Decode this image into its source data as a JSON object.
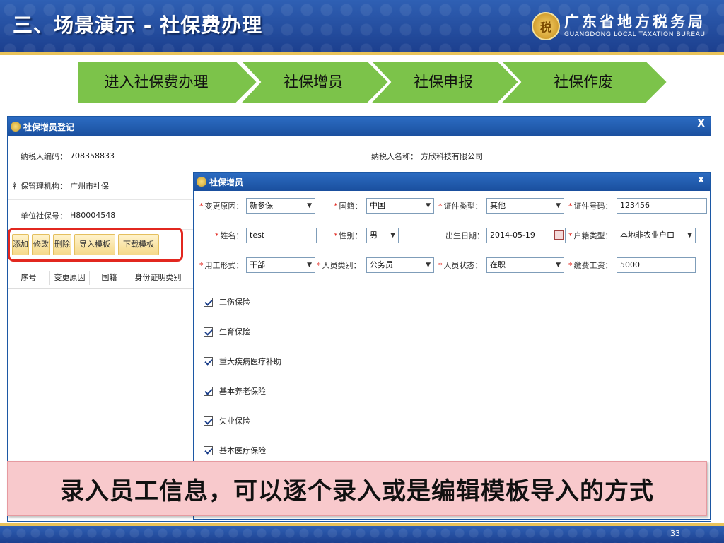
{
  "slide": {
    "title": "三、场景演示 - 社保费办理",
    "bureau_cn": "广东省地方税务局",
    "bureau_en": "GUANGDONG LOCAL TAXATION BUREAU",
    "page_number": "33"
  },
  "steps": [
    "进入社保费办理",
    "社保增员",
    "社保申报",
    "社保作废"
  ],
  "outer_dialog": {
    "title": "社保增员登记",
    "close": "X",
    "fields": {
      "taxpayer_id_label": "纳税人编码：",
      "taxpayer_id": "708358833",
      "taxpayer_name_label": "纳税人名称：",
      "taxpayer_name": "方欣科技有限公司",
      "agency_label": "社保管理机构：",
      "agency": "广州市社保",
      "unit_no_label": "单位社保号：",
      "unit_no": "H80004548"
    },
    "toolbar": [
      "添加",
      "修改",
      "删除",
      "导入模板",
      "下载模板"
    ],
    "grid_columns": [
      "序号",
      "变更原因",
      "国籍",
      "身份证明类别"
    ]
  },
  "inner_dialog": {
    "title": "社保增员",
    "close": "x",
    "required_mark": "*",
    "fields": {
      "change_reason_label": "变更原因：",
      "change_reason": "新参保",
      "nationality_label": "国籍：",
      "nationality": "中国",
      "id_type_label": "证件类型：",
      "id_type": "其他",
      "id_no_label": "证件号码：",
      "id_no": "123456",
      "name_label": "姓名：",
      "name": "test",
      "gender_label": "性别：",
      "gender": "男",
      "birth_label": "出生日期：",
      "birth": "2014-05-19",
      "household_label": "户籍类型：",
      "household": "本地非农业户口",
      "employment_label": "用工形式：",
      "employment": "干部",
      "person_type_label": "人员类别：",
      "person_type": "公务员",
      "status_label": "人员状态：",
      "status": "在职",
      "wage_label": "缴费工资：",
      "wage": "5000"
    },
    "insurances": [
      "工伤保险",
      "生育保险",
      "重大疾病医疗补助",
      "基本养老保险",
      "失业保险",
      "基本医疗保险"
    ]
  },
  "banner": "录入员工信息，可以逐个录入或是编辑模板导入的方式",
  "colors": {
    "accent_blue": "#1c58a5",
    "step_green": "#7cc34a",
    "highlight_red": "#e2271f",
    "banner_pink": "#f8c9cc"
  }
}
